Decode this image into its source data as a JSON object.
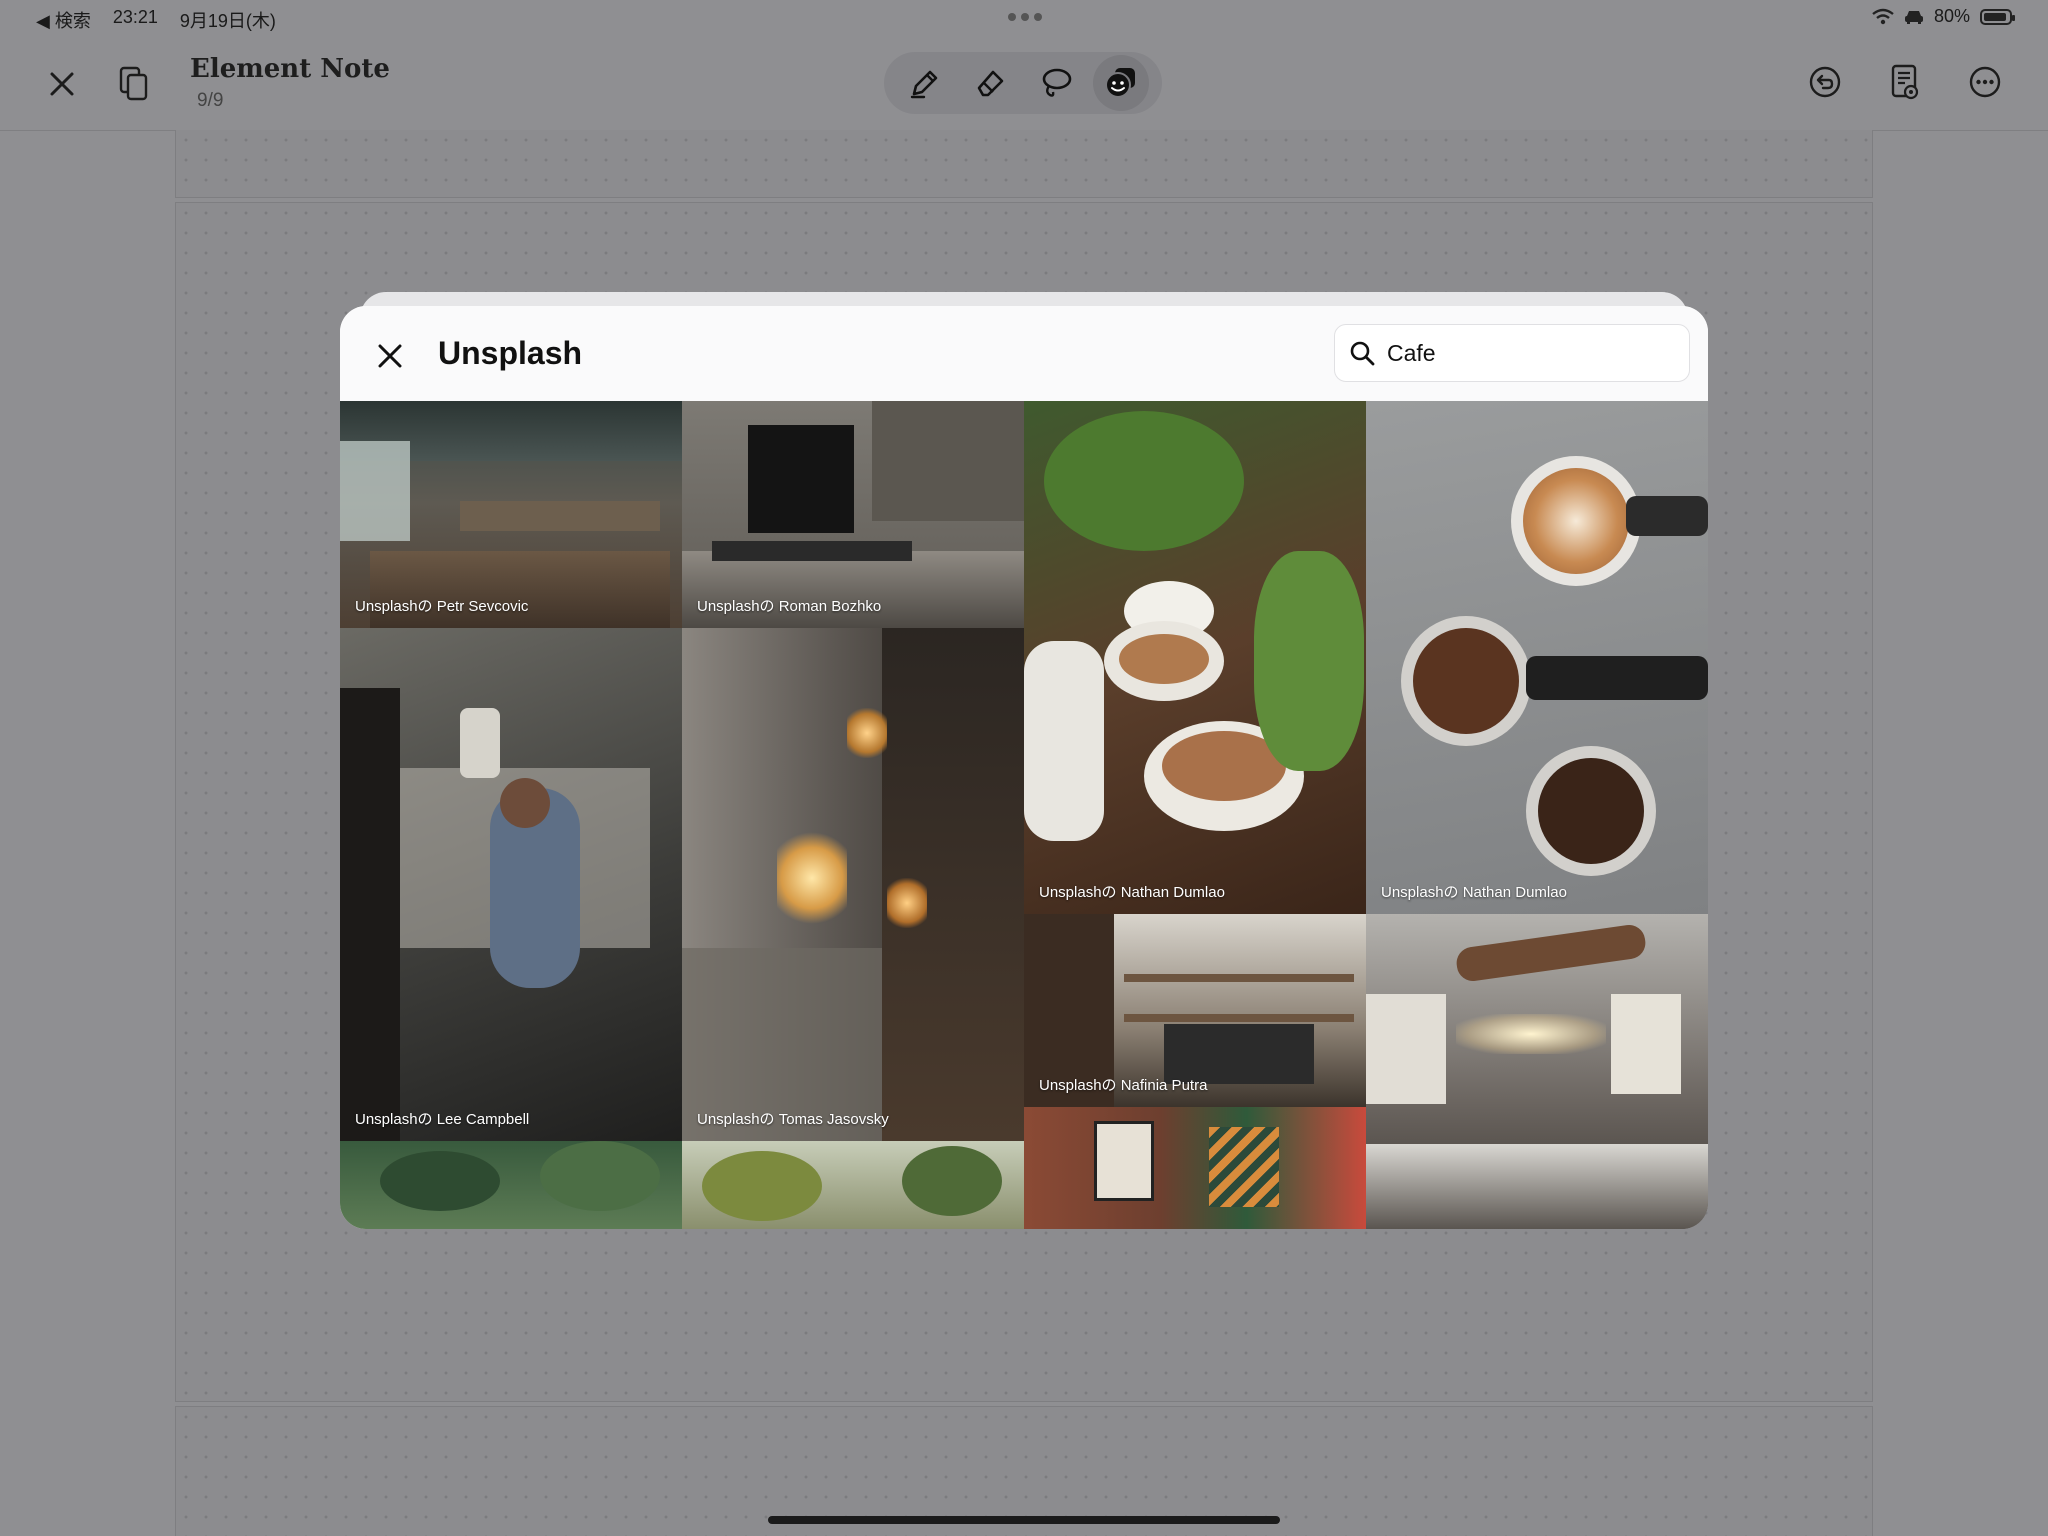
{
  "status_bar": {
    "back_label": "◀ 検索",
    "time": "23:21",
    "date": "9月19日(木)",
    "battery": "80%"
  },
  "toolbar": {
    "title": "Element Note",
    "page_indicator": "9/9",
    "tools": [
      "pen-icon",
      "eraser-icon",
      "lasso-icon",
      "sticker-icon"
    ],
    "active_tool": "sticker-icon"
  },
  "modal": {
    "title": "Unsplash",
    "search": {
      "value": "Cafe"
    },
    "photos": [
      {
        "credit": "Unsplashの Petr Sevcovic"
      },
      {
        "credit": "Unsplashの Roman Bozhko"
      },
      {
        "credit": "Unsplashの Nathan Dumlao"
      },
      {
        "credit": "Unsplashの Nathan Dumlao"
      },
      {
        "credit": "Unsplashの Lee  Campbell"
      },
      {
        "credit": "Unsplashの Tomas Jasovsky"
      },
      {
        "credit": "Unsplashの Nafinia Putra"
      },
      {
        "credit": ""
      },
      {
        "credit": ""
      },
      {
        "credit": ""
      },
      {
        "credit": ""
      }
    ]
  },
  "colors": {
    "background_dimmed": "#8f8f92",
    "modal_bg": "#ffffff",
    "credit_text": "#ffffff"
  }
}
